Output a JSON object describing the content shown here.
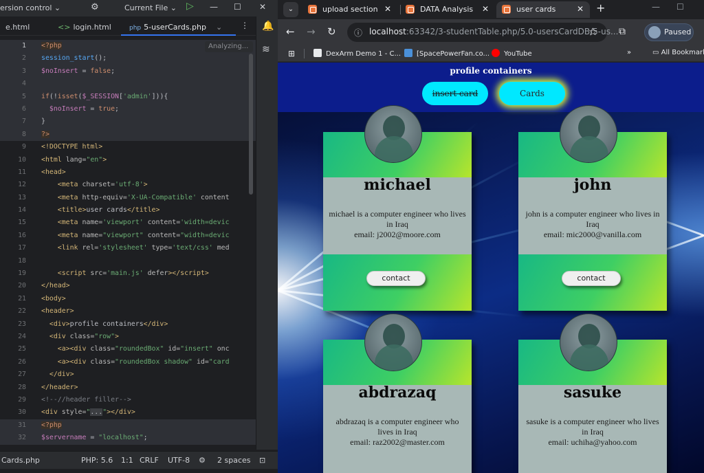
{
  "ide": {
    "vcs_label": "ersion control",
    "vcs_chevron": "⌄",
    "run_config": "Current File",
    "run_config_chevron": "⌄",
    "tabs": [
      {
        "label": "e.html"
      },
      {
        "label": "login.html"
      },
      {
        "label": "5-userCards.php",
        "icon_text": "php"
      }
    ],
    "analyzing": "Analyzing...",
    "status": {
      "file": "Cards.php",
      "php": "PHP: 5.6",
      "position": "1:1",
      "line_ending": "CRLF",
      "encoding": "UTF-8",
      "indent": "2 spaces"
    }
  },
  "browser": {
    "tabs": [
      {
        "label": "upload section"
      },
      {
        "label": "DATA Analysis"
      },
      {
        "label": "user cards"
      }
    ],
    "url_host": "localhost",
    "url_rest": ":63342/3-studentTable.php/5.0-usersCardDB/5-us...",
    "profile_status": "Paused",
    "bookmarks": [
      "DexArm Demo 1 - C...",
      "[SpacePowerFan.co...",
      "YouTube"
    ],
    "bookmarks_more": "»",
    "bookmarks_folder": "All Bookmarks"
  },
  "page": {
    "header_title": "profile containers",
    "insert_button": "insert card",
    "cards_button": "Cards",
    "contact_label": "contact",
    "users": [
      {
        "name": "michael",
        "desc": "michael is a computer engineer who lives in Iraq",
        "email": "email: j2002@moore.com"
      },
      {
        "name": "john",
        "desc": "john is a computer engineer who lives in Iraq",
        "email": "email: mic2000@vanilla.com"
      },
      {
        "name": "abdrazaq",
        "desc": "abdrazaq is a computer engineer who lives in Iraq",
        "email": "email: raz2002@master.com"
      },
      {
        "name": "sasuke",
        "desc": "sasuke is a computer engineer who lives in Iraq",
        "email": "email: uchiha@yahoo.com"
      }
    ]
  },
  "colors": {
    "ide_bg": "#1e1f22",
    "cyan_button": "#00e8ff",
    "glow": "#d8f53a",
    "card_gray": "#a8b8b6",
    "card_green_start": "#18b884",
    "card_green_end": "#b7e52c"
  },
  "icons": {
    "ide_top": [
      "gear-icon",
      "run-icon",
      "minimize-icon",
      "maximize-icon",
      "close-icon"
    ],
    "ide_side": [
      "notifications-icon",
      "database-icon"
    ],
    "browser_nav": [
      "back-icon",
      "forward-icon",
      "reload-icon",
      "site-info-icon",
      "star-icon",
      "extensions-icon"
    ]
  }
}
